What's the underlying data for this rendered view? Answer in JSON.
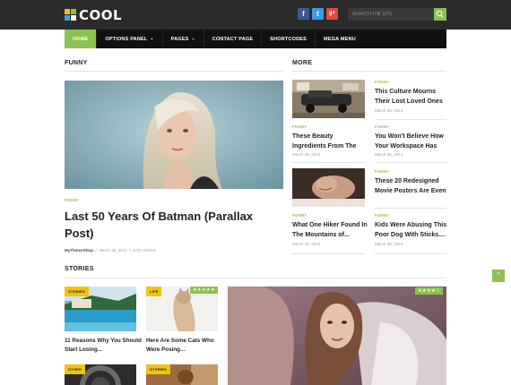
{
  "site": {
    "logo_text": "COOL",
    "colors": {
      "accent": "#8dc153",
      "topbar": "#2b2b2b",
      "nav": "#111111",
      "tag": "#f1c40f"
    }
  },
  "header": {
    "social": [
      {
        "name": "facebook-icon",
        "glyph": "f",
        "color": "#3b5998"
      },
      {
        "name": "twitter-icon",
        "glyph": "t",
        "color": "#3b9ee5"
      },
      {
        "name": "google-plus-icon",
        "glyph": "g+",
        "color": "#dd4b39"
      }
    ],
    "search_placeholder": "SEARCH THE SITE"
  },
  "nav": {
    "items": [
      {
        "label": "HOME",
        "active": true
      },
      {
        "label": "OPTIONS PANEL",
        "dropdown": true
      },
      {
        "label": "PAGES",
        "dropdown": true
      },
      {
        "label": "CONTACT PAGE"
      },
      {
        "label": "SHORTCODES"
      },
      {
        "label": "MEGA MENU"
      }
    ]
  },
  "funny": {
    "heading": "FUNNY",
    "category": "FUNNY",
    "title": "Last 50 Years Of Batman (Parallax Post)",
    "author": "MyThemeShop",
    "date": "March 26, 2014",
    "views": "4726 VIEWS",
    "sep": "/"
  },
  "more": {
    "heading": "MORE",
    "items": [
      {
        "category": "FUNNY",
        "title": "This Culture Mourns Their Lost Loved Ones",
        "date": "March 26, 2014"
      },
      {
        "category": "FUNNY",
        "title": "These Beauty Ingredients From The",
        "date": "March 26, 2014"
      },
      {
        "category": "FUNNY",
        "title": "You Won't Believe How Your Workspace Has",
        "date": "March 26, 2014"
      },
      {
        "category": "FUNNY",
        "title": "These 20 Redesigned Movie Posters Are Even",
        "date": "March 26, 2014"
      },
      {
        "category": "FUNNY",
        "title": "What One Hiker Found In The Mountains of...",
        "date": "March 26, 2014"
      },
      {
        "category": "FUNNY",
        "title": "Kids Were Abusing This Poor Dog With Sticks....",
        "date": "March 26, 2014"
      }
    ]
  },
  "stories": {
    "heading": "STORIES",
    "items": [
      {
        "tag": "STORIES",
        "title": "11 Reasons Why You Should Start Losing..."
      },
      {
        "tag": "LIFE",
        "title": "Here Are Some Cats Who Were Posing...",
        "stars": "★★★★★"
      },
      {
        "tag": "OTHER"
      },
      {
        "tag": "STORIES"
      }
    ],
    "feature_stars": "★★★★☆"
  },
  "back_to_top": "^"
}
